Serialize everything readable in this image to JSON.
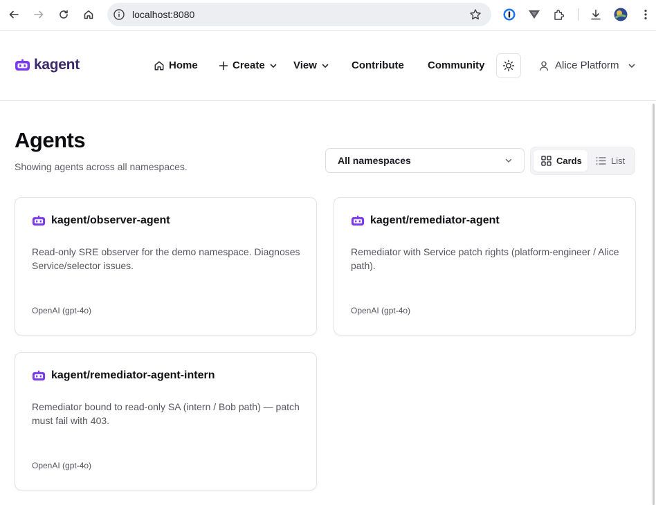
{
  "browser": {
    "url": "localhost:8080"
  },
  "header": {
    "logo_text": "kagent",
    "nav": {
      "home": "Home",
      "create": "Create",
      "view": "View",
      "contribute": "Contribute",
      "community": "Community"
    },
    "user": "Alice Platform"
  },
  "page": {
    "title": "Agents",
    "subtitle": "Showing agents across all namespaces.",
    "namespace_select": "All namespaces",
    "view_toggle": {
      "cards": "Cards",
      "list": "List",
      "selected": "Cards"
    }
  },
  "agents": [
    {
      "name": "kagent/observer-agent",
      "description": "Read-only SRE observer for the demo namespace. Diagnoses Service/selector issues.",
      "model": "OpenAI (gpt-4o)"
    },
    {
      "name": "kagent/remediator-agent",
      "description": "Remediator with Service patch rights (platform-engineer / Alice path).",
      "model": "OpenAI (gpt-4o)"
    },
    {
      "name": "kagent/remediator-agent-intern",
      "description": "Remediator bound to read-only SA (intern / Bob path) — patch must fail with 403.",
      "model": "OpenAI (gpt-4o)"
    }
  ],
  "colors": {
    "brand": "#7c3aed",
    "logo_text": "#3a2a6b"
  }
}
